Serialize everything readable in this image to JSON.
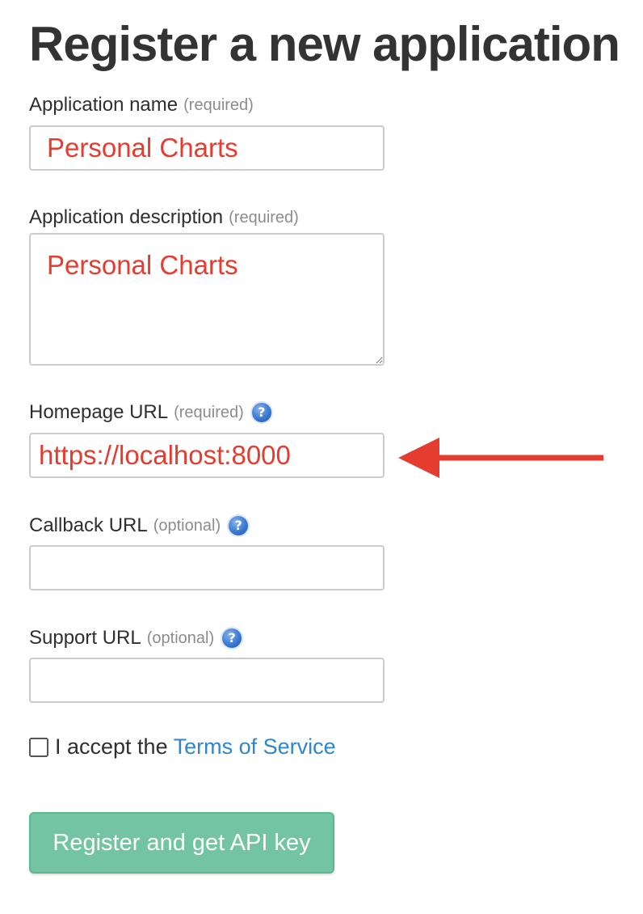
{
  "page": {
    "title": "Register a new application"
  },
  "form": {
    "app_name": {
      "label": "Application name",
      "hint": "(required)",
      "value": "Personal Charts"
    },
    "app_description": {
      "label": "Application description",
      "hint": "(required)",
      "value": "Personal Charts"
    },
    "homepage_url": {
      "label": "Homepage URL",
      "hint": "(required)",
      "value": "https://localhost:8000",
      "help_icon": "question-icon"
    },
    "callback_url": {
      "label": "Callback URL",
      "hint": "(optional)",
      "value": "",
      "help_icon": "question-icon"
    },
    "support_url": {
      "label": "Support URL",
      "hint": "(optional)",
      "value": "",
      "help_icon": "question-icon"
    },
    "terms": {
      "prefix": "I accept the",
      "link_text": "Terms of Service",
      "checked": false
    },
    "submit_label": "Register and get API key"
  },
  "annotation": {
    "arrow_icon": "left-arrow-icon",
    "color": "#e43d2f"
  },
  "colors": {
    "input_text": "#e43d2f",
    "link": "#2f86c8",
    "submit_button": "#73c4a2"
  }
}
